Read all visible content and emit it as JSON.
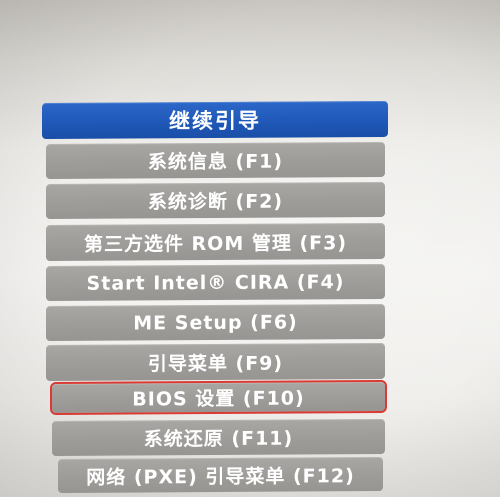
{
  "boot_menu": {
    "items": [
      {
        "label": "继续引导",
        "selected": true
      },
      {
        "label": "系统信息 (F1)"
      },
      {
        "label": "系统诊断 (F2)"
      },
      {
        "label": "第三方选件 ROM 管理 (F3)"
      },
      {
        "label": "Start Intel® CIRA (F4)"
      },
      {
        "label": "ME Setup (F6)"
      },
      {
        "label": "引导菜单 (F9)"
      },
      {
        "label": "BIOS 设置 (F10)",
        "highlighted": true
      },
      {
        "label": "系统还原 (F11)"
      },
      {
        "label": "网络 (PXE) 引导菜单 (F12)"
      }
    ]
  },
  "colors": {
    "selected_item": "#1f58b8",
    "item": "#9f9d9a",
    "highlight_box": "#d93a33",
    "text": "#ffffff"
  }
}
